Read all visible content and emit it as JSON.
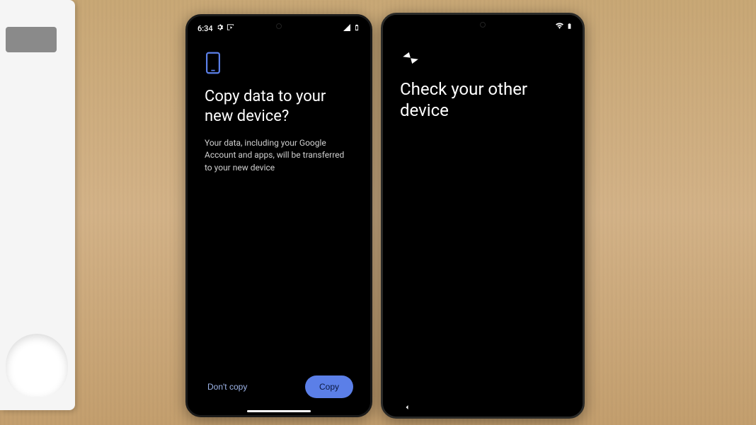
{
  "phone1": {
    "status": {
      "time": "6:34",
      "settings_icon": "gear",
      "cast_icon": "cast",
      "signal_icon": "signal",
      "battery_icon": "battery"
    },
    "icon": "phone-outline",
    "title": "Copy data to your new device?",
    "description": "Your data, including your Google Account and apps, will be transferred to your new device",
    "buttons": {
      "secondary": "Don't copy",
      "primary": "Copy"
    }
  },
  "phone2": {
    "status": {
      "wifi_icon": "wifi",
      "battery_icon": "battery"
    },
    "icon": "transfer-arrows",
    "title": "Check your other device"
  }
}
